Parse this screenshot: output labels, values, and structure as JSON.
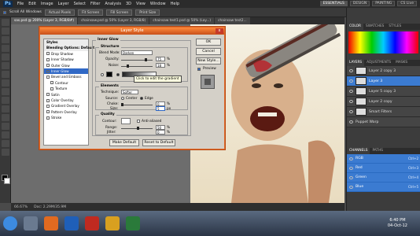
{
  "menubar": {
    "logo": "Ps",
    "items": [
      "File",
      "Edit",
      "Image",
      "Layer",
      "Select",
      "Filter",
      "Analysis",
      "3D",
      "View",
      "Window",
      "Help"
    ],
    "workspace": "ESSENTIALS",
    "design": "DESIGN",
    "painting": "PAINTING",
    "cslive": "CS Live"
  },
  "options": {
    "scroll_all": "Scroll All Windows",
    "actual_pixels": "Actual Pixels",
    "fit_screen": "Fit Screen",
    "fill_screen": "Fill Screen",
    "print_size": "Print Size"
  },
  "tabs": [
    {
      "label": "sas.psd @ 200% (Layer 3, RGB/8#)"
    },
    {
      "label": "chainsaw.psd @ 50% (Layer 3, RGB/8)"
    },
    {
      "label": "chainsaw test1.psd @ 50% (Lay...)"
    },
    {
      "label": "chainsaw test2..."
    }
  ],
  "status": {
    "zoom": "66.67%",
    "doc": "Doc: 2.29M/35.9M"
  },
  "right": {
    "color_tabs": [
      "COLOR",
      "SWATCHES",
      "STYLES"
    ],
    "layer_tabs": [
      "LAYERS",
      "ADJUSTMENTS",
      "MASKS"
    ],
    "layers": [
      {
        "name": "Layer 2 copy 3",
        "sel": false
      },
      {
        "name": "Layer 3",
        "sel": true
      },
      {
        "name": "Layer 5 copy 3",
        "sel": false
      },
      {
        "name": "Layer 2 copy",
        "sel": false
      },
      {
        "name": "Smart Filters",
        "sel": false
      },
      {
        "name": "Puppet Warp",
        "sel": false
      }
    ],
    "channel_tabs": [
      "CHANNELS",
      "PATHS"
    ],
    "channels": [
      {
        "name": "RGB",
        "shortcut": "Ctrl+2"
      },
      {
        "name": "Red",
        "shortcut": "Ctrl+3"
      },
      {
        "name": "Green",
        "shortcut": "Ctrl+4"
      },
      {
        "name": "Blue",
        "shortcut": "Ctrl+5"
      }
    ]
  },
  "taskbar": {
    "time": "6:40 PM",
    "date": "04-Oct-12"
  },
  "dialog": {
    "title": "Layer Style",
    "close": "x",
    "styles_head": "Styles",
    "blending": "Blending Options: Default",
    "items": [
      {
        "label": "Drop Shadow",
        "on": false,
        "sel": false
      },
      {
        "label": "Inner Shadow",
        "on": false,
        "sel": false
      },
      {
        "label": "Outer Glow",
        "on": false,
        "sel": false
      },
      {
        "label": "Inner Glow",
        "on": true,
        "sel": true
      },
      {
        "label": "Bevel and Emboss",
        "on": false,
        "sel": false
      },
      {
        "label": "Contour",
        "on": false,
        "sel": false
      },
      {
        "label": "Texture",
        "on": false,
        "sel": false
      },
      {
        "label": "Satin",
        "on": false,
        "sel": false
      },
      {
        "label": "Color Overlay",
        "on": false,
        "sel": false
      },
      {
        "label": "Gradient Overlay",
        "on": false,
        "sel": false
      },
      {
        "label": "Pattern Overlay",
        "on": false,
        "sel": false
      },
      {
        "label": "Stroke",
        "on": false,
        "sel": false
      }
    ],
    "inner_glow": "Inner Glow",
    "structure": "Structure",
    "blend_mode_label": "Blend Mode:",
    "blend_mode": "Darken",
    "opacity_label": "Opacity:",
    "opacity": "75",
    "noise_label": "Noise:",
    "noise": "18",
    "percent": "%",
    "elements": "Elements",
    "technique_label": "Technique:",
    "technique": "Softer",
    "source_label": "Source:",
    "source_center": "Center",
    "source_edge": "Edge",
    "choke_label": "Choke:",
    "choke": "0",
    "size_label": "Size:",
    "size": "5",
    "px": "px",
    "quality": "Quality",
    "contour_label": "Contour:",
    "antialiased": "Anti-aliased",
    "range_label": "Range:",
    "range": "50",
    "jitter_label": "Jitter:",
    "jitter": "0",
    "make_default": "Make Default",
    "reset_default": "Reset to Default",
    "ok": "OK",
    "cancel": "Cancel",
    "new_style": "New Style...",
    "preview": "Preview",
    "tooltip": "Click to edit the gradient"
  }
}
